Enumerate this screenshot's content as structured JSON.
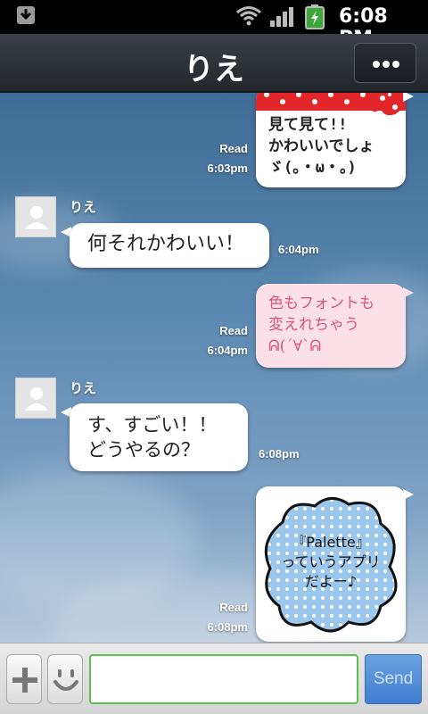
{
  "status_bar": {
    "time": "6:08 PM"
  },
  "header": {
    "title": "りえ"
  },
  "messages": [
    {
      "side": "right",
      "read": "Read",
      "time": "6:03pm",
      "lines": [
        "見て見て!!",
        "かわいいでしょ",
        "ゞ(。・ω・。)"
      ],
      "style": "ribbon-sticker"
    },
    {
      "side": "left",
      "sender": "りえ",
      "time": "6:04pm",
      "lines": [
        "何それかわいい！"
      ]
    },
    {
      "side": "right",
      "read": "Read",
      "time": "6:04pm",
      "lines": [
        "色もフォントも",
        "変えれちゃう",
        "ᕱ(´∀`ᕱ"
      ],
      "style": "pink-handwritten"
    },
    {
      "side": "left",
      "sender": "りえ",
      "time": "6:08pm",
      "lines": [
        "す、すごい！！",
        "どうやるの？"
      ]
    },
    {
      "side": "right",
      "read": "Read",
      "time": "6:08pm",
      "lines": [
        "『Palette』",
        "っていうアプリ",
        "だよー♪"
      ],
      "style": "blue-cloud"
    }
  ],
  "input_bar": {
    "placeholder": "",
    "send_label": "Send"
  },
  "colors": {
    "accent_green": "#58c24a",
    "send_blue": "#3f7fd0",
    "pink_bubble": "#fbe0e8",
    "ribbon_red": "#e2262a"
  }
}
